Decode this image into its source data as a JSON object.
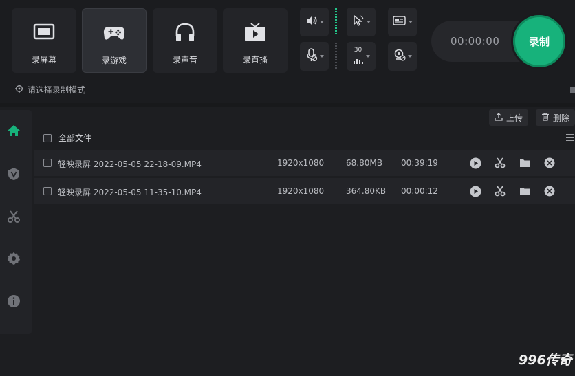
{
  "modes": [
    {
      "label": "录屏幕",
      "icon": "screen-icon"
    },
    {
      "label": "录游戏",
      "icon": "gamepad-icon"
    },
    {
      "label": "录声音",
      "icon": "headphones-icon"
    },
    {
      "label": "录直播",
      "icon": "live-tv-icon"
    }
  ],
  "controls": {
    "fps_value": "30"
  },
  "timer": "00:00:00",
  "record_label": "录制",
  "mode_hint": "请选择录制模式",
  "toolbar": {
    "upload_label": "上传",
    "delete_label": "删除"
  },
  "file_list": {
    "header_label": "全部文件",
    "rows": [
      {
        "name": "轻映录屏 2022-05-05 22-18-09.MP4",
        "resolution": "1920x1080",
        "size": "68.80MB",
        "duration": "00:39:19"
      },
      {
        "name": "轻映录屏 2022-05-05 11-35-10.MP4",
        "resolution": "1920x1080",
        "size": "364.80KB",
        "duration": "00:00:12"
      }
    ]
  },
  "watermark": "996传奇",
  "colors": {
    "accent": "#17b27b",
    "background": "#1d1e21"
  }
}
